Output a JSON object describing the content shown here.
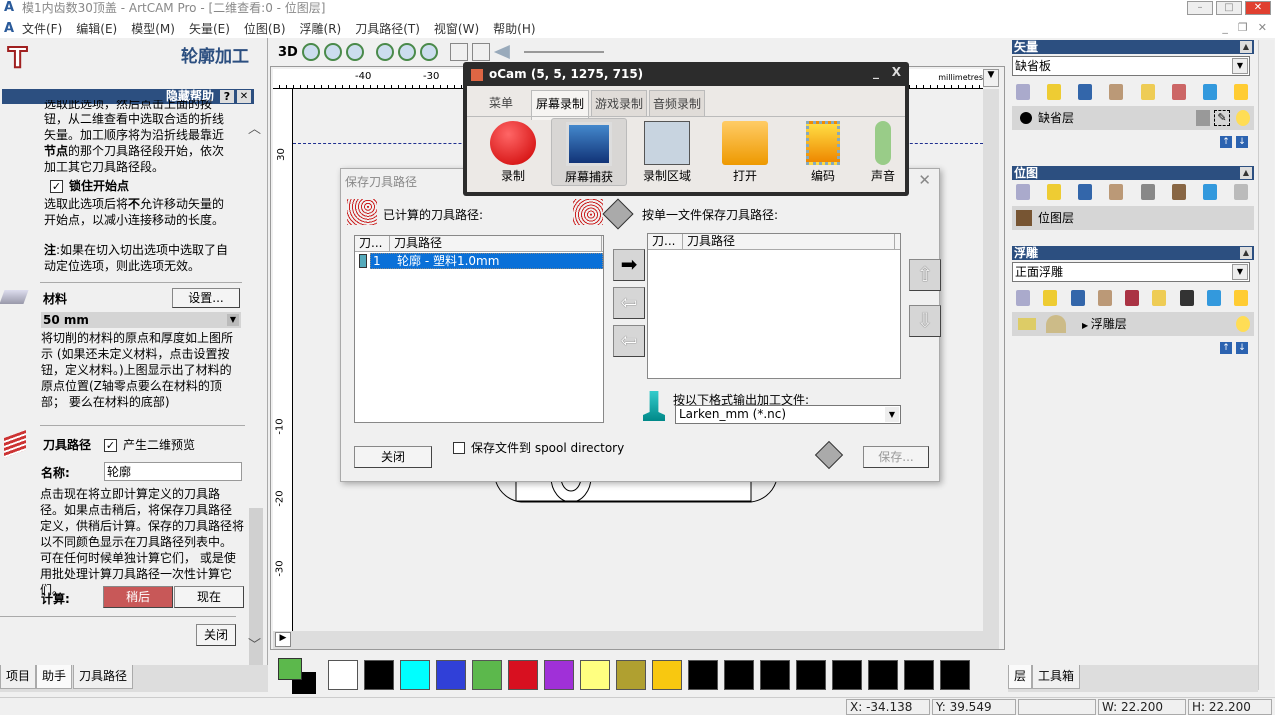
{
  "window": {
    "title": "模1内齿数30顶盖 - ArtCAM Pro - [二维查看:0 - 位图层]",
    "minimize": "–",
    "maximize": "□",
    "close": "✕"
  },
  "menu": [
    "文件(F)",
    "编辑(E)",
    "模型(M)",
    "矢量(E)",
    "位图(B)",
    "浮雕(R)",
    "刀具路径(T)",
    "视窗(W)",
    "帮助(H)"
  ],
  "left_panel": {
    "title": "轮廓加工",
    "help_bar": "隐藏帮助",
    "help_q": "?",
    "help_x": "✕",
    "help_text1a": "选取此选项，然后点击上面的按",
    "help_text1b": "钮，从二维查看中选取合适的折线",
    "help_text1c": "矢量。加工顺序将为沿折线最靠近",
    "help_text1d_bold": "节点",
    "help_text1d": "的那个刀具路径段开始，依次",
    "help_text1e": "加工其它刀具路径段。",
    "lock_start": "锁住开始点",
    "lock_checked": true,
    "lock_text1a": "选取此选项后将",
    "lock_text1b": "不",
    "lock_text1c": "允许移动矢量的",
    "lock_text2": "开始点，以减小连接移动的长度。",
    "note_bold": "注",
    "note1": ":如果在切入切出选项中选取了自",
    "note2": "动定位选项，则此选项无效。",
    "material_label": "材料",
    "material_button": "设置...",
    "material_value": "50 mm",
    "material_text": [
      "将切削的材料的原点和厚度如上图所",
      "示 (如果还未定义材料，点击设置按",
      "钮，定义材料。)上图显示出了材料的",
      "原点位置(Z轴零点要么在材料的顶",
      "部；  要么在材料的底部)"
    ],
    "toolpath_label": "刀具路径",
    "preview_label": "产生二维预览",
    "preview_checked": true,
    "name_label": "名称:",
    "name_value": "轮廓",
    "calc_text": [
      "点击现在将立即计算定义的刀具路",
      "径。如果点击稍后，将保存刀具路径",
      "定义，供稍后计算。保存的刀具路径将",
      "以不同颜色显示在刀具路径列表中。",
      "可在任何时候单独计算它们， 或是使",
      "用批处理计算刀具路径一次性计算它",
      "们。"
    ],
    "calc_label": "计算:",
    "later_button": "稍后",
    "now_button": "现在",
    "close_button": "关闭",
    "tabs": [
      "项目",
      "助手",
      "刀具路径"
    ],
    "active_tab": "助手"
  },
  "toolbar": {
    "3d": "3D"
  },
  "rulers": {
    "top": [
      "-40",
      "-30"
    ],
    "left": [
      "30",
      "-10",
      "-20",
      "-30"
    ],
    "units": "millimetres"
  },
  "palette": {
    "colors": [
      "#ffffff",
      "#000000",
      "#00ffff",
      "#3040d8",
      "#5cb84c",
      "#d81020",
      "#a030d8",
      "#ffff80",
      "#b0a030",
      "#f8c810",
      "#000000",
      "#000000",
      "#000000",
      "#000000",
      "#000000",
      "#000000",
      "#000000",
      "#000000"
    ],
    "foreground": "#5cb84c",
    "background": "#000000"
  },
  "right_panel": {
    "vector": {
      "title": "矢量",
      "sheet": "缺省板",
      "layer": "缺省层"
    },
    "bitmap": {
      "title": "位图",
      "layer": "位图层"
    },
    "relief": {
      "title": "浮雕",
      "combo": "正面浮雕",
      "layer": "浮雕层"
    },
    "tabs": [
      "层",
      "工具箱"
    ]
  },
  "status": {
    "x": "X: -34.138",
    "y": "Y: 39.549",
    "blank": "",
    "w": "W: 22.200",
    "h": "H: 22.200"
  },
  "ocam": {
    "title": "oCam (5, 5, 1275, 715)",
    "min": "_",
    "close": "X",
    "tabs": [
      "菜单",
      "屏幕录制",
      "游戏录制",
      "音频录制"
    ],
    "active_tab": "屏幕录制",
    "buttons": [
      "录制",
      "屏幕捕获",
      "录制区域",
      "打开",
      "编码",
      "声音"
    ],
    "active_button": "屏幕捕获"
  },
  "dialog": {
    "title": "保存刀具路径",
    "close": "✕",
    "computed_label": "已计算的刀具路径:",
    "single_file_label": "按单一文件保存刀具路径:",
    "columns": [
      "刀...",
      "刀具路径"
    ],
    "computed_rows": [
      {
        "num": "1",
        "name": "轮廓 - 塑料1.0mm",
        "selected": true
      }
    ],
    "output_label": "按以下格式输出加工文件:",
    "format": "Larken_mm (*.nc)",
    "spool_label": "保存文件到 spool directory",
    "spool_checked": false,
    "close_button": "关闭",
    "save_button": "保存..."
  }
}
